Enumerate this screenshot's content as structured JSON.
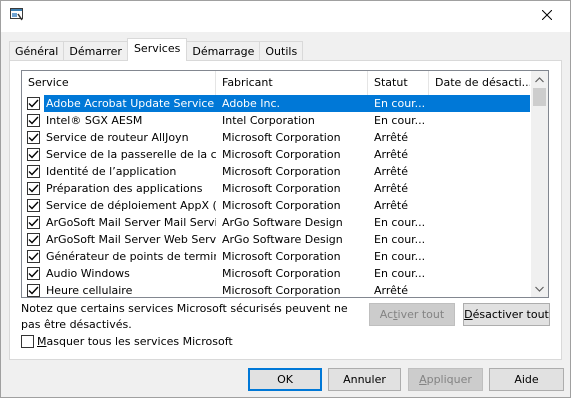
{
  "window": {
    "app_icon": "msconfig-icon",
    "close_icon": "close-icon"
  },
  "tabs": [
    {
      "label": "Général",
      "active": false
    },
    {
      "label": "Démarrer",
      "active": false
    },
    {
      "label": "Services",
      "active": true
    },
    {
      "label": "Démarrage",
      "active": false
    },
    {
      "label": "Outils",
      "active": false
    }
  ],
  "services": {
    "columns": [
      "Service",
      "Fabricant",
      "Statut",
      "Date de désacti..."
    ],
    "rows": [
      {
        "checked": true,
        "name": "Adobe Acrobat Update Service",
        "maker": "Adobe Inc.",
        "status": "En cour...",
        "date": "",
        "selected": true
      },
      {
        "checked": true,
        "name": "Intel® SGX AESM",
        "maker": "Intel Corporation",
        "status": "En cour...",
        "date": "",
        "selected": false
      },
      {
        "checked": true,
        "name": "Service de routeur AllJoyn",
        "maker": "Microsoft Corporation",
        "status": "Arrêté",
        "date": "",
        "selected": false
      },
      {
        "checked": true,
        "name": "Service de la passerelle de la co...",
        "maker": "Microsoft Corporation",
        "status": "Arrêté",
        "date": "",
        "selected": false
      },
      {
        "checked": true,
        "name": "Identité de l’application",
        "maker": "Microsoft Corporation",
        "status": "Arrêté",
        "date": "",
        "selected": false
      },
      {
        "checked": true,
        "name": "Préparation des applications",
        "maker": "Microsoft Corporation",
        "status": "Arrêté",
        "date": "",
        "selected": false
      },
      {
        "checked": true,
        "name": "Service de déploiement AppX (A...",
        "maker": "Microsoft Corporation",
        "status": "Arrêté",
        "date": "",
        "selected": false
      },
      {
        "checked": true,
        "name": "ArGoSoft Mail Server Mail Services",
        "maker": "ArGo Software Design",
        "status": "En cour...",
        "date": "",
        "selected": false
      },
      {
        "checked": true,
        "name": "ArGoSoft Mail Server Web Service",
        "maker": "ArGo Software Design",
        "status": "En cour...",
        "date": "",
        "selected": false
      },
      {
        "checked": true,
        "name": "Générateur de points de termina...",
        "maker": "Microsoft Corporation",
        "status": "En cour...",
        "date": "",
        "selected": false
      },
      {
        "checked": true,
        "name": "Audio Windows",
        "maker": "Microsoft Corporation",
        "status": "En cour...",
        "date": "",
        "selected": false
      },
      {
        "checked": true,
        "name": "Heure cellulaire",
        "maker": "Microsoft Corporation",
        "status": "Arrêté",
        "date": "",
        "selected": false
      }
    ]
  },
  "note": "Notez que certains services Microsoft sécurisés peuvent ne pas être désactivés.",
  "buttons": {
    "enable_all": {
      "pre": "Ac",
      "key": "t",
      "post": "iver tout"
    },
    "disable_all": {
      "pre": "",
      "key": "D",
      "post": "ésactiver tout"
    },
    "ok": "OK",
    "cancel": "Annuler",
    "apply": {
      "pre": "",
      "key": "A",
      "post": "ppliquer"
    },
    "help": "Aide"
  },
  "hide_ms": {
    "pre": "",
    "key": "M",
    "post": "asquer tous les services Microsoft",
    "checked": false
  },
  "colors": {
    "selection": "#0078d7",
    "default_button_border": "#0078d7"
  }
}
